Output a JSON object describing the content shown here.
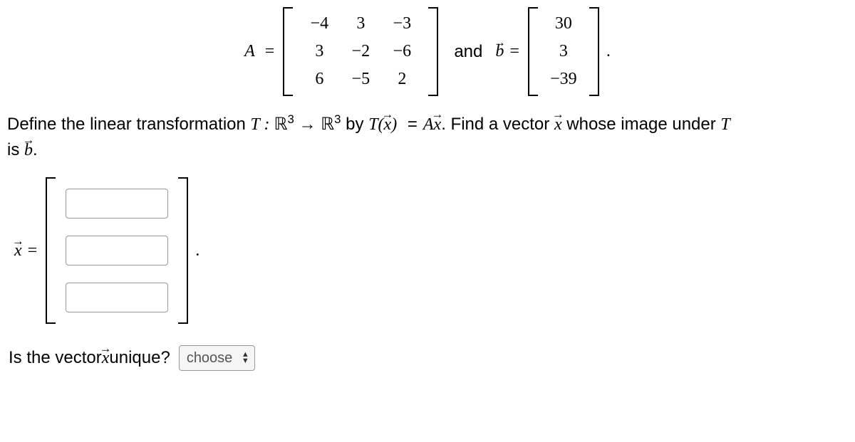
{
  "matrix_A_label": "A",
  "equals": "=",
  "A": [
    [
      "−4",
      "3",
      "−3"
    ],
    [
      "3",
      "−2",
      "−6"
    ],
    [
      "6",
      "−5",
      "2"
    ]
  ],
  "and_text": "and",
  "vector_b_label": "b",
  "b": [
    "30",
    "3",
    "−39"
  ],
  "period": ".",
  "question_p1": "Define the linear transformation ",
  "T_label": "T",
  "colon_space": " : ",
  "R_label": "ℝ",
  "R_exp": "3",
  "arrow": " → ",
  "by_text": " by ",
  "Tx_expr_left": "T(",
  "x_label": "x",
  "Tx_expr_right": ")",
  "Ax_text_1": "A",
  "question_p2": ". Find a vector ",
  "question_p3": " whose image under ",
  "is_text": "is ",
  "x_equals_label": "x",
  "unique_question_p1": "Is the vector ",
  "unique_question_p2": " unique?",
  "select_placeholder": "choose"
}
